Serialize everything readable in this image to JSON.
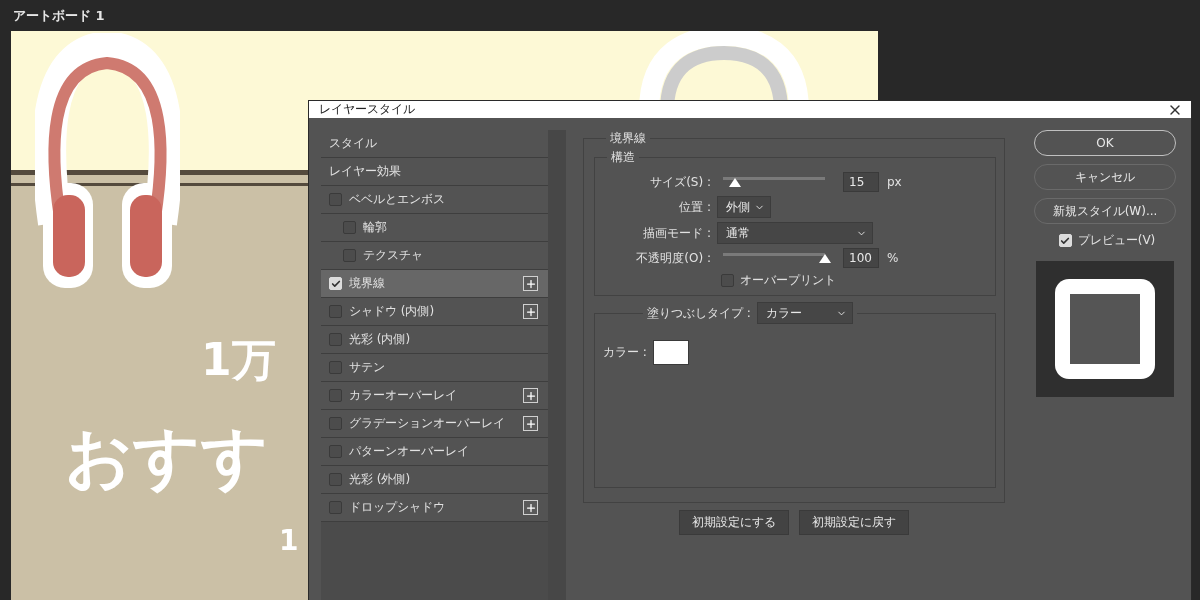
{
  "artboard": {
    "title": "アートボード 1",
    "headline_1": "1万",
    "headline_2": "おすす",
    "headline_3": "1"
  },
  "dialog": {
    "title": "レイヤースタイル",
    "style_list": [
      {
        "kind": "header",
        "label": "スタイル",
        "selected": false
      },
      {
        "kind": "header",
        "label": "レイヤー効果",
        "selected": false
      },
      {
        "kind": "effect",
        "label": "ベベルとエンボス",
        "checked": false,
        "selected": false,
        "addable": false,
        "children": [
          {
            "kind": "effect",
            "label": "輪郭",
            "checked": false,
            "selected": false,
            "addable": false
          },
          {
            "kind": "effect",
            "label": "テクスチャ",
            "checked": false,
            "selected": false,
            "addable": false
          }
        ]
      },
      {
        "kind": "effect",
        "label": "境界線",
        "checked": true,
        "selected": true,
        "addable": true
      },
      {
        "kind": "effect",
        "label": "シャドウ (内側)",
        "checked": false,
        "selected": false,
        "addable": true
      },
      {
        "kind": "effect",
        "label": "光彩 (内側)",
        "checked": false,
        "selected": false,
        "addable": false
      },
      {
        "kind": "effect",
        "label": "サテン",
        "checked": false,
        "selected": false,
        "addable": false
      },
      {
        "kind": "effect",
        "label": "カラーオーバーレイ",
        "checked": false,
        "selected": false,
        "addable": true
      },
      {
        "kind": "effect",
        "label": "グラデーションオーバーレイ",
        "checked": false,
        "selected": false,
        "addable": true
      },
      {
        "kind": "effect",
        "label": "パターンオーバーレイ",
        "checked": false,
        "selected": false,
        "addable": false
      },
      {
        "kind": "effect",
        "label": "光彩 (外側)",
        "checked": false,
        "selected": false,
        "addable": false
      },
      {
        "kind": "effect",
        "label": "ドロップシャドウ",
        "checked": false,
        "selected": false,
        "addable": true
      }
    ],
    "stroke": {
      "title": "境界線",
      "structure_title": "構造",
      "size": {
        "label": "サイズ(S) :",
        "level": 0.12,
        "value": "15",
        "unit": "px"
      },
      "position": {
        "label": "位置 :",
        "value": "外側"
      },
      "blend_mode": {
        "label": "描画モード :",
        "value": "通常"
      },
      "opacity": {
        "label": "不透明度(O) :",
        "level": 1.0,
        "value": "100",
        "unit": "%"
      },
      "overprint": {
        "label": "オーバープリント",
        "checked": false
      },
      "fill_type": {
        "label": "塗りつぶしタイプ :",
        "value": "カラー"
      },
      "fill_color": {
        "label": "カラー :",
        "color": "#ffffff"
      },
      "buttons": [
        "初期設定にする",
        "初期設定に戻す"
      ]
    },
    "side_buttons": [
      {
        "label": "OK",
        "selected": true
      },
      {
        "label": "キャンセル",
        "selected": false
      },
      {
        "label": "新規スタイル(W)...",
        "selected": false
      }
    ],
    "preview": {
      "label": "プレビュー(V)",
      "checked": true
    }
  }
}
